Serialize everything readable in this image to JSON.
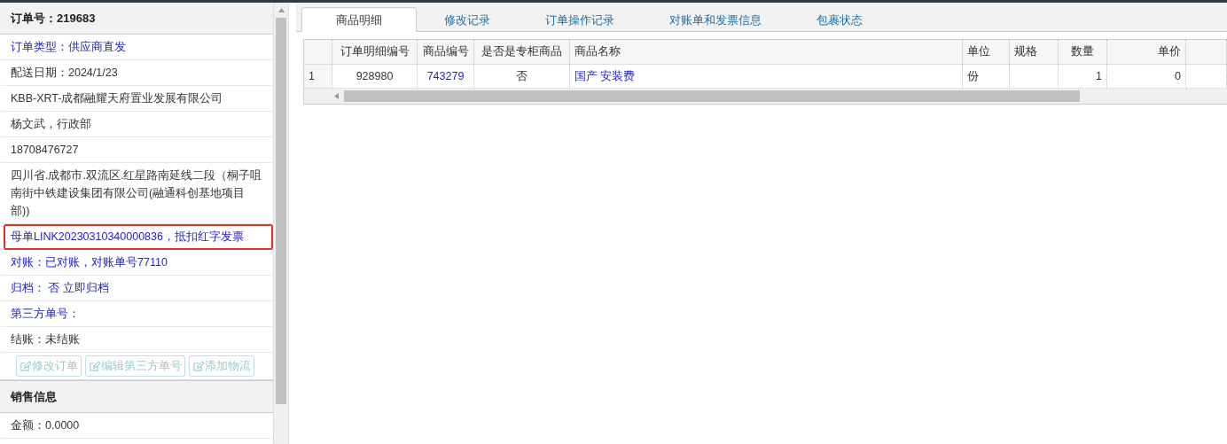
{
  "order_panel": {
    "title": "订单号：219683",
    "rows": [
      {
        "text": "订单类型：供应商直发",
        "kind": "link",
        "highlighted": false
      },
      {
        "text": "配送日期：2024/1/23",
        "kind": "text",
        "highlighted": false
      },
      {
        "text": "KBB-XRT-成都融耀天府置业发展有限公司",
        "kind": "text",
        "highlighted": false
      },
      {
        "text": "杨文武，行政部",
        "kind": "text",
        "highlighted": false
      },
      {
        "text": "18708476727",
        "kind": "text",
        "highlighted": false
      },
      {
        "text": "四川省.成都市.双流区.红星路南延线二段（桐子咀南街中铁建设集团有限公司(融通科创基地项目部))",
        "kind": "text",
        "highlighted": false
      },
      {
        "text": "母单LINK20230310340000836，抵扣红字发票",
        "kind": "link",
        "highlighted": true
      },
      {
        "text": "对账：已对账，对账单号77110",
        "kind": "link",
        "highlighted": false
      },
      {
        "text": "归档： 否 立即归档",
        "kind": "link",
        "highlighted": false
      },
      {
        "text": "第三方单号：",
        "kind": "link",
        "highlighted": false
      },
      {
        "text": "结账：未结账",
        "kind": "text",
        "highlighted": false
      }
    ],
    "buttons": [
      {
        "label": "修改订单",
        "disabled": true
      },
      {
        "label": "编辑第三方单号",
        "disabled": true
      },
      {
        "label": "添加物流",
        "disabled": true
      }
    ]
  },
  "sales_panel": {
    "title": "销售信息",
    "rows": [
      {
        "text": "金额：0.0000",
        "kind": "text",
        "highlighted": false
      }
    ]
  },
  "tabs": [
    {
      "label": "商品明细",
      "selected": true
    },
    {
      "label": "修改记录",
      "selected": false
    },
    {
      "label": "订单操作记录",
      "selected": false
    },
    {
      "label": "对账单和发票信息",
      "selected": false
    },
    {
      "label": "包裹状态",
      "selected": false
    }
  ],
  "table": {
    "columns": [
      "订单明细编号",
      "商品编号",
      "是否是专柜商品",
      "商品名称",
      "单位",
      "规格",
      "数量",
      "单价"
    ],
    "rows": [
      {
        "number": "1",
        "cells": [
          {
            "text": "928980",
            "kind": "text"
          },
          {
            "text": "743279",
            "kind": "link"
          },
          {
            "text": "否",
            "kind": "text"
          },
          {
            "text": "国产 安装费",
            "kind": "link"
          },
          {
            "text": "份",
            "kind": "text"
          },
          {
            "text": "",
            "kind": "text"
          },
          {
            "text": "1",
            "kind": "text"
          },
          {
            "text": "0",
            "kind": "text"
          }
        ]
      }
    ]
  }
}
